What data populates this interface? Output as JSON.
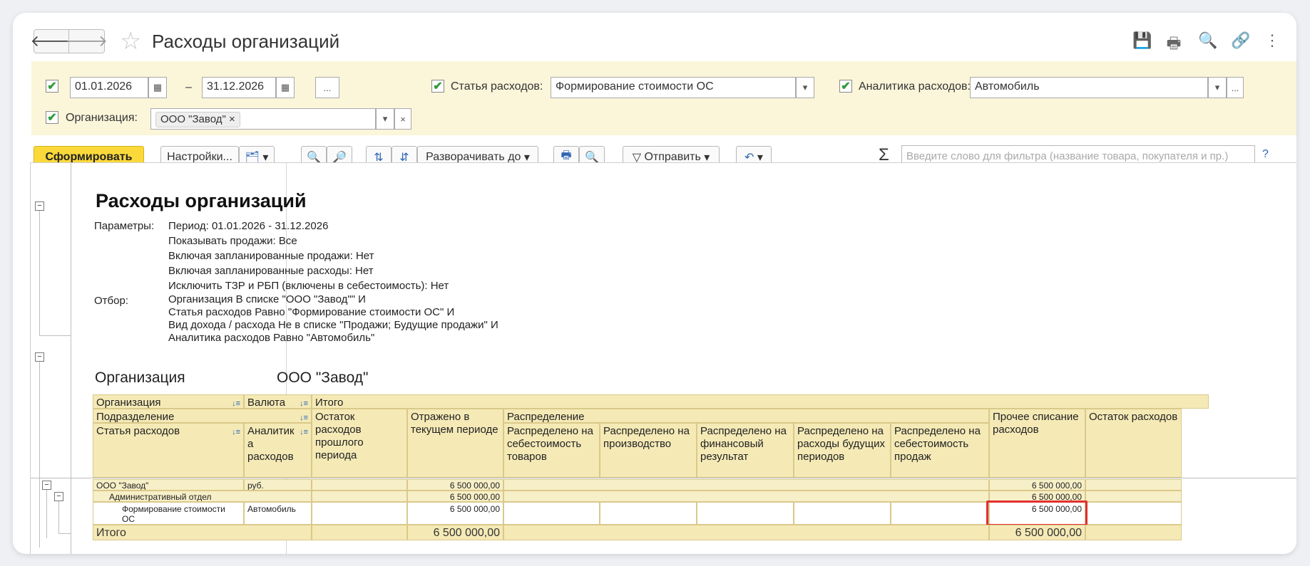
{
  "window": {
    "title": "Расходы организаций",
    "back_glyph": "🡐",
    "forward_glyph": "🡒",
    "star_glyph": "☆",
    "icons": [
      "save-icon",
      "print-icon",
      "preview-icon",
      "link-icon",
      "more-icon"
    ],
    "icon_glyphs": [
      "💾",
      "🖶",
      "🔍",
      "🔗",
      "⋮"
    ]
  },
  "filters": {
    "date_from": "01.01.2026",
    "date_sep": "–",
    "date_to": "31.12.2026",
    "ellipsis": "...",
    "expense_item_label": "Статья расходов:",
    "expense_item_value": "Формирование стоимости ОС",
    "analytics_label": "Аналитика расходов:",
    "analytics_value": "Автомобиль",
    "org_label": "Организация:",
    "org_tag": "ООО \"Завод\"",
    "clear_glyph": "×",
    "dropdown_glyph": "▾",
    "calendar_glyph": "▦",
    "check_glyph": "✔"
  },
  "toolbar": {
    "generate": "Сформировать",
    "settings": "Настройки...",
    "expand_to": "Разворачивать до",
    "send": "Отправить",
    "search_placeholder": "Введите слово для фильтра (название товара, покупателя и пр.)",
    "sigma": "Σ",
    "help": "?"
  },
  "report": {
    "title": "Расходы организаций",
    "params_label": "Параметры:",
    "params": [
      "Период: 01.01.2026 - 31.12.2026",
      "Показывать продажи: Все",
      "Включая запланированные продажи: Нет",
      "Включая запланированные расходы: Нет",
      "Исключить ТЗР и РБП (включены в себестоимость): Нет"
    ],
    "filter_label": "Отбор:",
    "filters": [
      "Организация В списке \"ООО \"Завод\"\" И",
      "Статья расходов Равно \"Формирование стоимости ОС\" И",
      "Вид дохода / расхода Не в списке \"Продажи; Будущие продажи\" И",
      "Аналитика расходов Равно \"Автомобиль\""
    ],
    "org_heading_label": "Организация",
    "org_heading_value": "ООО \"Завод\""
  },
  "table": {
    "h_org": "Организация",
    "h_currency": "Валюта",
    "h_total": "Итого",
    "h_division": "Подразделение",
    "h_item": "Статья расходов",
    "h_analytics": "Аналитик а расходов",
    "h_balance_prev": "Остаток расходов прошлого периода",
    "h_reflected": "Отражено в текущем периоде",
    "h_distribution": "Распределение",
    "h_d_goods": "Распределено на себестоимость товаров",
    "h_d_production": "Распределено на производство",
    "h_d_financial": "Распределено на финансовый результат",
    "h_d_future": "Распределено на расходы будущих периодов",
    "h_d_sales": "Распределено на себестоимость продаж",
    "h_other": "Прочее списание расходов",
    "h_balance": "Остаток расходов",
    "rows": [
      {
        "name": "ООО \"Завод\"",
        "analytics": "руб.",
        "reflected": "6 500 000,00",
        "other": "6 500 000,00"
      },
      {
        "name": "Административный отдел",
        "analytics": "",
        "reflected": "6 500 000,00",
        "other": "6 500 000,00"
      },
      {
        "name": "Формирование стоимости ОС",
        "analytics": "Автомобиль",
        "reflected": "6 500 000,00",
        "other": "6 500 000,00"
      }
    ],
    "total_label": "Итого",
    "total_reflected": "6 500 000,00",
    "total_other": "6 500 000,00",
    "sort_glyph": "↓≡",
    "collapse_glyph": "−"
  },
  "colors": {
    "accent_yellow": "#fbd93a",
    "panel_yellow": "#fbf5da",
    "header_yellow": "#f5eab6",
    "highlight_red": "#e03030",
    "check_green": "#2e9b3a"
  }
}
